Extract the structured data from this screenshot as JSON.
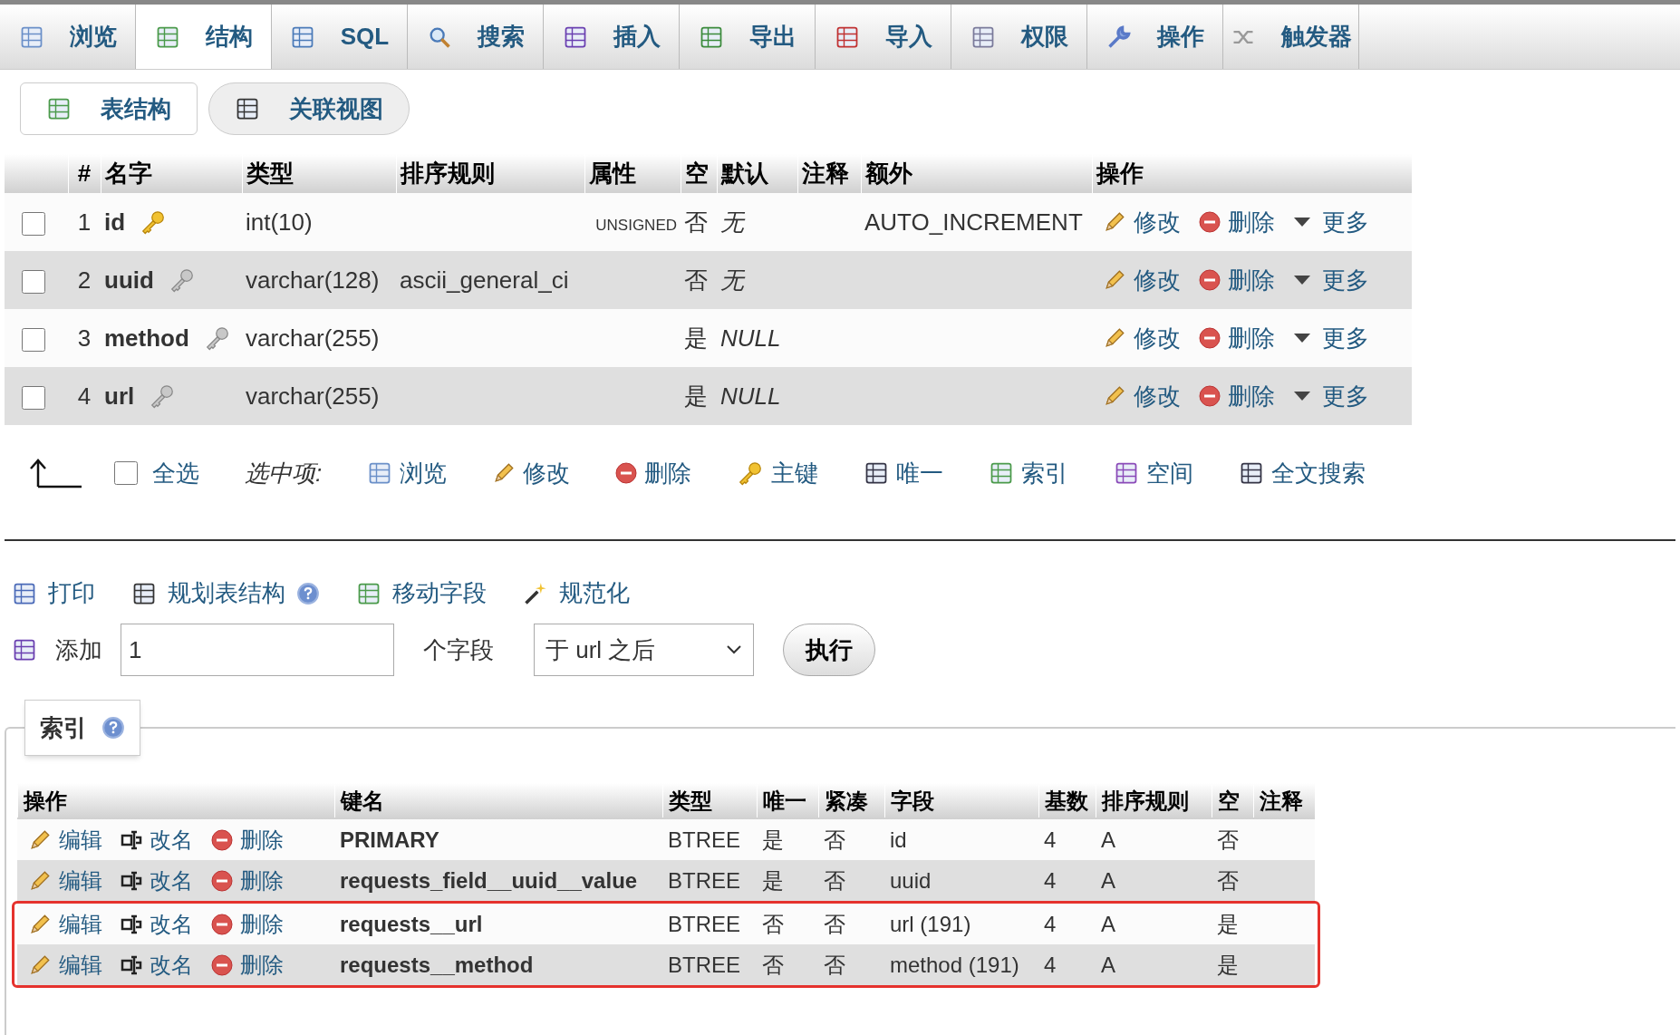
{
  "tabs": [
    {
      "label": "浏览",
      "selected": false
    },
    {
      "label": "结构",
      "selected": true
    },
    {
      "label": "SQL",
      "selected": false
    },
    {
      "label": "搜索",
      "selected": false
    },
    {
      "label": "插入",
      "selected": false
    },
    {
      "label": "导出",
      "selected": false
    },
    {
      "label": "导入",
      "selected": false
    },
    {
      "label": "权限",
      "selected": false
    },
    {
      "label": "操作",
      "selected": false
    },
    {
      "label": "触发器",
      "selected": false
    }
  ],
  "subtabs": [
    {
      "label": "表结构",
      "selected": true
    },
    {
      "label": "关联视图",
      "selected": false
    }
  ],
  "structure": {
    "columns": [
      "#",
      "名字",
      "类型",
      "排序规则",
      "属性",
      "空",
      "默认",
      "注释",
      "额外",
      "操作"
    ],
    "rows": [
      {
        "number": "1",
        "name": "id",
        "primary_key": true,
        "checked": false,
        "type": "int(10)",
        "collation": "",
        "attributes": "UNSIGNED",
        "null": "否",
        "default": "无",
        "extra": "AUTO_INCREMENT",
        "actions": [
          "修改",
          "删除",
          "更多"
        ]
      },
      {
        "number": "2",
        "name": "uuid",
        "primary_key": false,
        "checked": false,
        "type": "varchar(128)",
        "collation": "ascii_general_ci",
        "attributes": "",
        "null": "否",
        "default": "无",
        "extra": "",
        "actions": [
          "修改",
          "删除",
          "更多"
        ]
      },
      {
        "number": "3",
        "name": "method",
        "primary_key": false,
        "checked": false,
        "type": "varchar(255)",
        "collation": "",
        "attributes": "",
        "null": "是",
        "default": "NULL",
        "extra": "",
        "actions": [
          "修改",
          "删除",
          "更多"
        ]
      },
      {
        "number": "4",
        "name": "url",
        "primary_key": false,
        "checked": false,
        "type": "varchar(255)",
        "collation": "",
        "attributes": "",
        "null": "是",
        "default": "NULL",
        "extra": "",
        "actions": [
          "修改",
          "删除",
          "更多"
        ]
      }
    ]
  },
  "bulk": {
    "check_all": "全选",
    "check_all_checked": false,
    "with_selected": "选中项:",
    "actions": [
      "浏览",
      "修改",
      "删除",
      "主键",
      "唯一",
      "索引",
      "空间",
      "全文搜索"
    ]
  },
  "toolbar": [
    "打印",
    "规划表结构",
    "移动字段",
    "规范化"
  ],
  "add_fields": {
    "label": "添加",
    "value": "1",
    "unit": "个字段",
    "position": "于 url 之后",
    "button": "执行"
  },
  "indexes": {
    "legend": "索引",
    "columns": [
      "操作",
      "键名",
      "类型",
      "唯一",
      "紧凑",
      "字段",
      "基数",
      "排序规则",
      "空",
      "注释"
    ],
    "rows": [
      {
        "actions": [
          "编辑",
          "改名",
          "删除"
        ],
        "key_name": "PRIMARY",
        "type": "BTREE",
        "unique": "是",
        "packed": "否",
        "column": "id",
        "cardinality": "4",
        "collation": "A",
        "null": "否",
        "highlighted": false
      },
      {
        "actions": [
          "编辑",
          "改名",
          "删除"
        ],
        "key_name": "requests_field__uuid__value",
        "type": "BTREE",
        "unique": "是",
        "packed": "否",
        "column": "uuid",
        "cardinality": "4",
        "collation": "A",
        "null": "否",
        "highlighted": false
      },
      {
        "actions": [
          "编辑",
          "改名",
          "删除"
        ],
        "key_name": "requests__url",
        "type": "BTREE",
        "unique": "否",
        "packed": "否",
        "column": "url (191)",
        "cardinality": "4",
        "collation": "A",
        "null": "是",
        "highlighted": true
      },
      {
        "actions": [
          "编辑",
          "改名",
          "删除"
        ],
        "key_name": "requests__method",
        "type": "BTREE",
        "unique": "否",
        "packed": "否",
        "column": "method (191)",
        "cardinality": "4",
        "collation": "A",
        "null": "是",
        "highlighted": true
      }
    ]
  }
}
